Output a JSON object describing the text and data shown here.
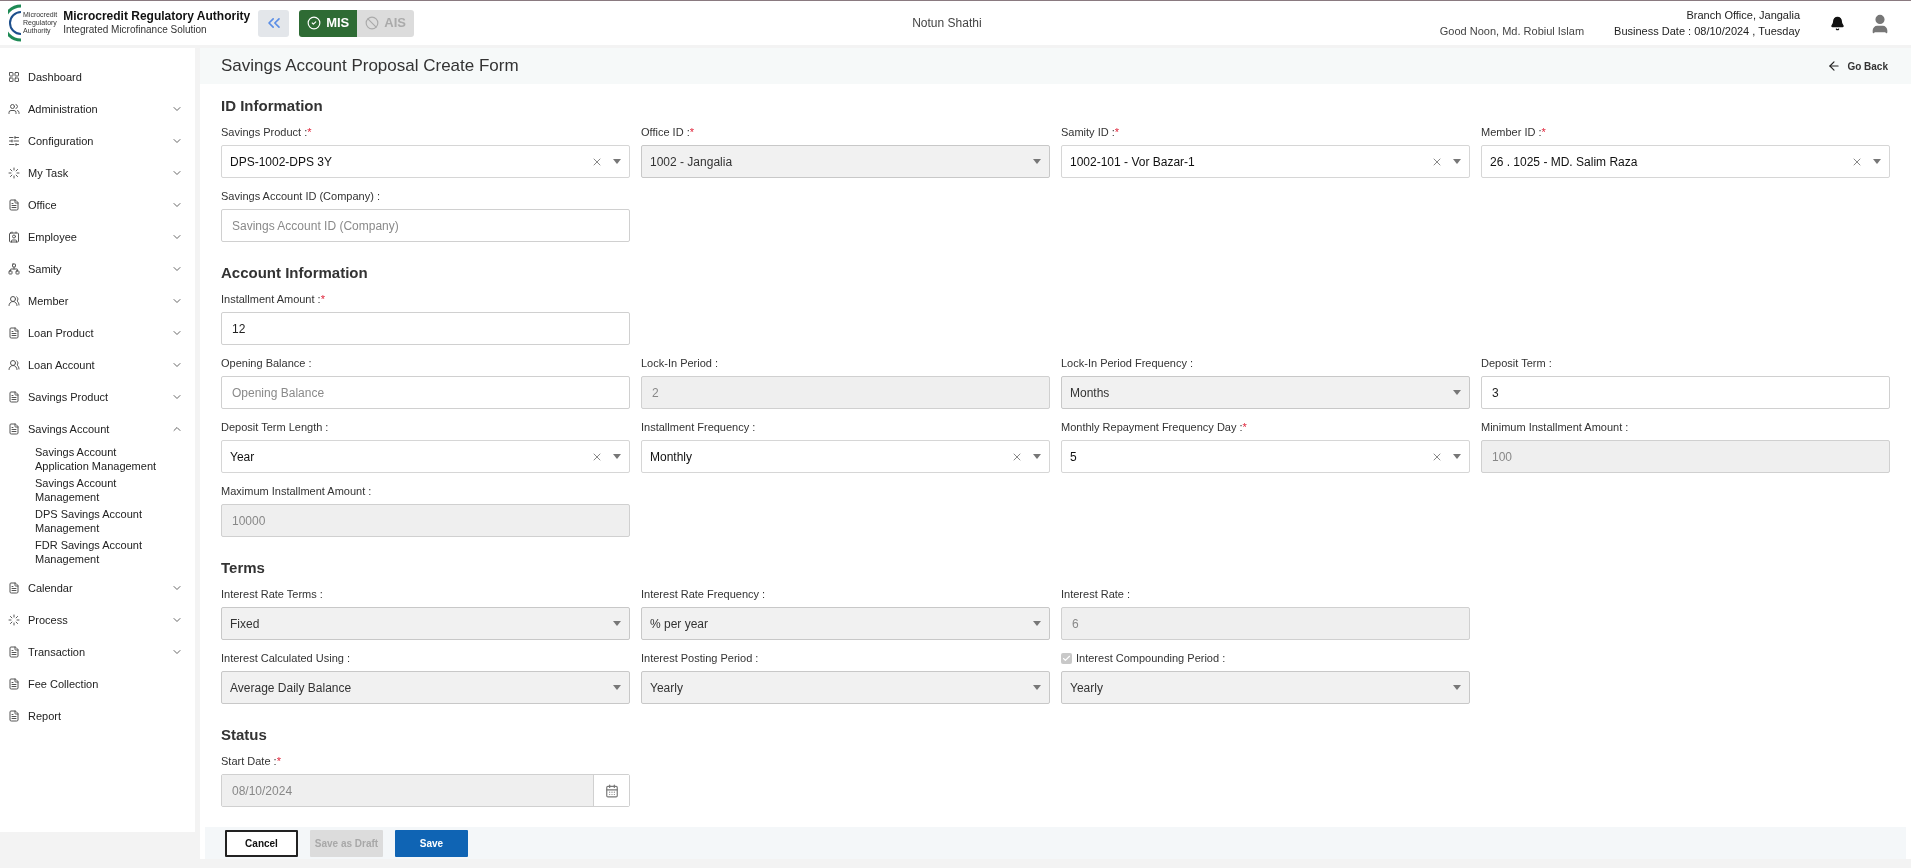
{
  "header": {
    "logo_text": [
      "Microcredit",
      "Regulatory",
      "Authority"
    ],
    "title": "Microcredit Regulatory Authority",
    "subtitle": "Integrated Microfinance Solution",
    "modules": [
      {
        "label": "MIS",
        "selected": true
      },
      {
        "label": "AIS",
        "selected": false
      }
    ],
    "organization": "Notun Shathi",
    "greeting": "Good Noon, Md. Robiul Islam",
    "branch": "Branch Office, Jangalia",
    "business_date": "Business Date : 08/10/2024 , Tuesday"
  },
  "sidebar": {
    "items": [
      {
        "label": "Dashboard",
        "kind": "link"
      },
      {
        "label": "Administration",
        "kind": "group",
        "expanded": false
      },
      {
        "label": "Configuration",
        "kind": "group",
        "expanded": false
      },
      {
        "label": "My Task",
        "kind": "group",
        "expanded": false
      },
      {
        "label": "Office",
        "kind": "group",
        "expanded": false
      },
      {
        "label": "Employee",
        "kind": "group",
        "expanded": false
      },
      {
        "label": "Samity",
        "kind": "group",
        "expanded": false
      },
      {
        "label": "Member",
        "kind": "group",
        "expanded": false
      },
      {
        "label": "Loan Product",
        "kind": "group",
        "expanded": false
      },
      {
        "label": "Loan Account",
        "kind": "group",
        "expanded": false
      },
      {
        "label": "Savings Product",
        "kind": "group",
        "expanded": false
      },
      {
        "label": "Savings Account",
        "kind": "group",
        "expanded": true,
        "children": [
          {
            "label": "Savings Account Application Management"
          },
          {
            "label": "Savings Account Management"
          },
          {
            "label": "DPS Savings Account Management"
          },
          {
            "label": "FDR Savings Account Management"
          }
        ]
      },
      {
        "label": "Calendar",
        "kind": "group",
        "expanded": false
      },
      {
        "label": "Process",
        "kind": "group",
        "expanded": false
      },
      {
        "label": "Transaction",
        "kind": "group",
        "expanded": false
      },
      {
        "label": "Fee Collection",
        "kind": "link"
      },
      {
        "label": "Report",
        "kind": "link"
      }
    ]
  },
  "page": {
    "title": "Savings Account Proposal Create Form",
    "back": "Go Back"
  },
  "sections": [
    {
      "heading": "ID Information",
      "rows": [
        [
          {
            "label": "Savings Product :",
            "mark": "*",
            "kind": "select",
            "value": "DPS-1002-DPS 3Y",
            "disabled": false,
            "clearable": true
          },
          {
            "label": "Office ID :",
            "mark": "*",
            "kind": "select",
            "value": "1002 - Jangalia",
            "disabled": true,
            "clearable": false
          },
          {
            "label": "Samity ID :",
            "mark": "*",
            "kind": "select",
            "value": "1002-101 - Vor Bazar-1",
            "disabled": false,
            "clearable": true
          },
          {
            "label": "Member ID :",
            "mark": "*",
            "kind": "select",
            "value": "26 . 1025 - MD. Salim Raza",
            "disabled": false,
            "clearable": true
          }
        ],
        [
          {
            "label": "Savings Account ID (Company) :",
            "kind": "input",
            "placeholder": "Savings Account ID (Company)",
            "disabled": false
          }
        ]
      ]
    },
    {
      "heading": "Account Information",
      "rows": [
        [
          {
            "label": "Installment Amount :",
            "mark": "*",
            "kind": "input",
            "value": "12",
            "disabled": false
          }
        ],
        [
          {
            "label": "Opening Balance :",
            "kind": "input",
            "placeholder": "Opening Balance",
            "disabled": false
          },
          {
            "label": "Lock-In Period :",
            "kind": "input",
            "value": "2",
            "disabled": true
          },
          {
            "label": "Lock-In Period Frequency :",
            "kind": "select",
            "value": "Months",
            "disabled": true,
            "clearable": false
          },
          {
            "label": "Deposit Term :",
            "kind": "input",
            "value": "3",
            "disabled": false
          }
        ],
        [
          {
            "label": "Deposit Term Length :",
            "kind": "select",
            "value": "Year",
            "disabled": false,
            "clearable": true
          },
          {
            "label": "Installment Frequency :",
            "kind": "select",
            "value": "Monthly",
            "disabled": false,
            "clearable": true
          },
          {
            "label": "Monthly Repayment Frequency Day :",
            "mark": "*",
            "kind": "select",
            "value": "5",
            "disabled": false,
            "clearable": true
          },
          {
            "label": "Minimum Installment Amount :",
            "kind": "input",
            "value": "100",
            "disabled": true
          }
        ],
        [
          {
            "label": "Maximum Installment Amount :",
            "kind": "input",
            "value": "10000",
            "disabled": true
          }
        ]
      ]
    },
    {
      "heading": "Terms",
      "rows": [
        [
          {
            "label": "Interest Rate Terms :",
            "kind": "select",
            "value": "Fixed",
            "disabled": true,
            "clearable": false
          },
          {
            "label": "Interest Rate Frequency :",
            "kind": "select",
            "value": "% per year",
            "disabled": true,
            "clearable": false
          },
          {
            "label": "Interest Rate :",
            "kind": "input",
            "value": "6",
            "disabled": true
          }
        ],
        [
          {
            "label": "Interest Calculated Using :",
            "kind": "select",
            "value": "Average Daily Balance",
            "disabled": true,
            "clearable": false
          },
          {
            "label": "Interest Posting Period :",
            "kind": "select",
            "value": "Yearly",
            "disabled": true,
            "clearable": false
          },
          {
            "label": "Interest Compounding Period :",
            "kind": "select",
            "value": "Yearly",
            "disabled": true,
            "clearable": false,
            "checkbox": {
              "checked": true
            }
          }
        ]
      ]
    },
    {
      "heading": "Status",
      "rows": [
        [
          {
            "label": "Start Date :",
            "mark": "*",
            "kind": "date",
            "value": "08/10/2024",
            "disabled": true
          }
        ]
      ]
    }
  ],
  "buttons": [
    {
      "label": "Cancel",
      "kind": "outline",
      "disabled": false
    },
    {
      "label": "Save as Draft",
      "kind": "secondary",
      "disabled": true
    },
    {
      "label": "Save",
      "kind": "primary",
      "disabled": false
    }
  ]
}
